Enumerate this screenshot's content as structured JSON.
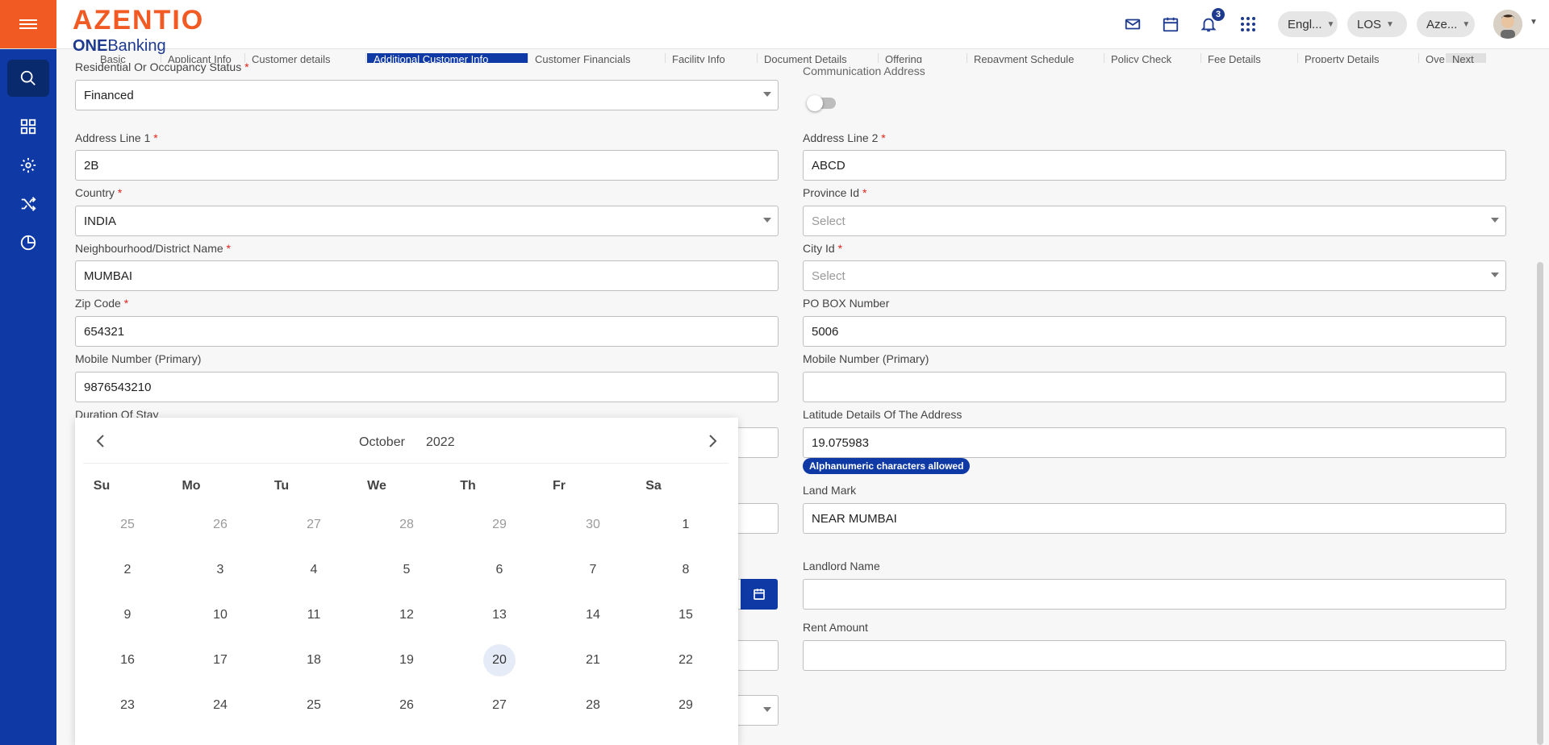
{
  "header": {
    "brand": "AZENTIO",
    "brand_sub_bold": "ONE",
    "brand_sub": "Banking",
    "notification_count": "3",
    "language": "Engl...",
    "module": "LOS",
    "entity": "Aze..."
  },
  "tabs": [
    {
      "label": "Basic"
    },
    {
      "label": "Applicant Info"
    },
    {
      "label": "Customer details"
    },
    {
      "label": "Additional Customer Info",
      "active": true
    },
    {
      "label": "Customer Financials"
    },
    {
      "label": "Facility Info"
    },
    {
      "label": "Document Details"
    },
    {
      "label": "Offering"
    },
    {
      "label": "Repayment Schedule"
    },
    {
      "label": "Policy Check"
    },
    {
      "label": "Fee Details"
    },
    {
      "label": "Property Details"
    },
    {
      "label": "Ove..."
    },
    {
      "label": "Next"
    }
  ],
  "form": {
    "residential_status_label": "Residential Or Occupancy Status",
    "residential_status_value": "Financed",
    "communication_address_label": "Communication Address",
    "address1_label": "Address Line 1",
    "address1_value": "2B",
    "address2_label": "Address Line 2",
    "address2_value": "ABCD",
    "country_label": "Country",
    "country_value": "INDIA",
    "province_label": "Province Id",
    "province_placeholder": "Select",
    "district_label": "Neighbourhood/District Name",
    "district_value": "MUMBAI",
    "city_label": "City Id",
    "city_placeholder": "Select",
    "zip_label": "Zip Code",
    "zip_value": "654321",
    "pobox_label": "PO BOX Number",
    "pobox_value": "5006",
    "mobile_left_label": "Mobile Number (Primary)",
    "mobile_left_value": "9876543210",
    "mobile_right_label": "Mobile Number (Primary)",
    "mobile_right_value": "",
    "duration_label": "Duration Of Stay",
    "latitude_label": "Latitude Details Of The Address",
    "latitude_value": "19.075983",
    "latitude_hint": "Alphanumeric characters allowed",
    "landmark_label": "Land Mark",
    "landmark_value": "NEAR MUMBAI",
    "landlord_label": "Landlord Name",
    "landlord_value": "",
    "rent_label": "Rent Amount",
    "rent_value": ""
  },
  "datepicker": {
    "month": "October",
    "year": "2022",
    "weekdays": [
      "Su",
      "Mo",
      "Tu",
      "We",
      "Th",
      "Fr",
      "Sa"
    ],
    "weeks": [
      [
        "25",
        "26",
        "27",
        "28",
        "29",
        "30",
        "1"
      ],
      [
        "2",
        "3",
        "4",
        "5",
        "6",
        "7",
        "8"
      ],
      [
        "9",
        "10",
        "11",
        "12",
        "13",
        "14",
        "15"
      ],
      [
        "16",
        "17",
        "18",
        "19",
        "20",
        "21",
        "22"
      ],
      [
        "23",
        "24",
        "25",
        "26",
        "27",
        "28",
        "29"
      ]
    ],
    "highlighted_day": "20"
  },
  "colors": {
    "brand_orange": "#f15a22",
    "primary_blue": "#0f3aa6",
    "required_red": "#e2231a"
  }
}
